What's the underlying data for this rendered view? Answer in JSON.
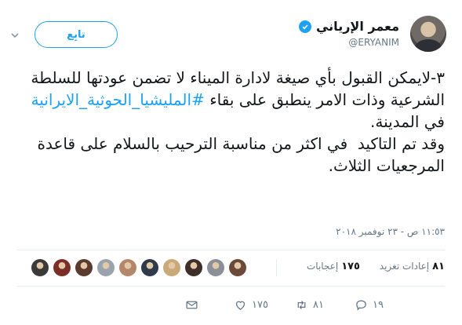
{
  "user": {
    "display_name": "معمر الإرياني",
    "handle": "@ERYANIM",
    "verified": true
  },
  "follow_button": {
    "label": "تابِع"
  },
  "tweet": {
    "text_before_hashtag": "٣-لايمكن القبول بأي صيغة لادارة الميناء لا تضمن عودتها للسلطة الشرعية وذات الامر ينطبق على بقاء ",
    "hashtag": "#المليشيا_الحوثية_الايرانية",
    "text_after_hashtag": " في المدينة.\nوقد تم التاكيد  في اكثر من مناسبة الترحيب بالسلام على قاعدة المرجعيات الثلاث.",
    "timestamp": "١١:٥٣ ص - ٢٣ نوفمبر ٢٠١٨"
  },
  "stats": {
    "retweets_count": "٨١",
    "retweets_label": "إعادات تغريد",
    "likes_count": "١٧٥",
    "likes_label": "إعجابات"
  },
  "likers": [
    {
      "color": "#6b4a3a"
    },
    {
      "color": "#8a8f98"
    },
    {
      "color": "#3e2f2a"
    },
    {
      "color": "#c9a97a"
    },
    {
      "color": "#2f3a4a"
    },
    {
      "color": "#b5876a"
    },
    {
      "color": "#9aa4ae"
    },
    {
      "color": "#5a3b2e"
    },
    {
      "color": "#7c2f2a"
    },
    {
      "color": "#3a3a3a"
    }
  ],
  "actions": {
    "reply_count": "١٩",
    "retweet_count": "٨١",
    "like_count": "١٧٥"
  },
  "colors": {
    "accent": "#1da1f2",
    "muted": "#657786",
    "text": "#14171a",
    "divider": "#e6ecf0"
  }
}
